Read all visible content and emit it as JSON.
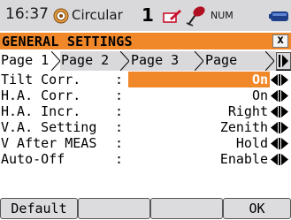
{
  "status": {
    "time": "16:37",
    "mode_icon": "target-icon",
    "mode": "Circular",
    "face_number": "1",
    "edit_icon": "edit-icon",
    "pole_icon": "prism-pole-icon",
    "input_mode": "NUM",
    "battery_icon": "battery-icon"
  },
  "titlebar": {
    "title": "GENERAL SETTINGS",
    "close_label": "x"
  },
  "tabs": [
    {
      "label": "Page 1",
      "active": true
    },
    {
      "label": "Page 2",
      "active": false
    },
    {
      "label": "Page 3",
      "active": false
    },
    {
      "label": "Page",
      "active": false
    }
  ],
  "settings": [
    {
      "label": "Tilt Corr.",
      "value": "On",
      "selected": true
    },
    {
      "label": "H.A. Corr.",
      "value": "On",
      "selected": false
    },
    {
      "label": "H.A. Incr.",
      "value": "Right",
      "selected": false
    },
    {
      "label": "V.A. Setting",
      "value": "Zenith",
      "selected": false
    },
    {
      "label": "V After MEAS",
      "value": "Hold",
      "selected": false
    },
    {
      "label": "Auto-Off",
      "value": "Enable",
      "selected": false
    }
  ],
  "colon": ":",
  "softkeys": {
    "default_label": "Default",
    "blank1": "",
    "blank2": "",
    "ok_label": "OK"
  },
  "colors": {
    "accent": "#f0882a",
    "statusbar": "#d9d9dc",
    "softkey": "#dcdcdf"
  }
}
